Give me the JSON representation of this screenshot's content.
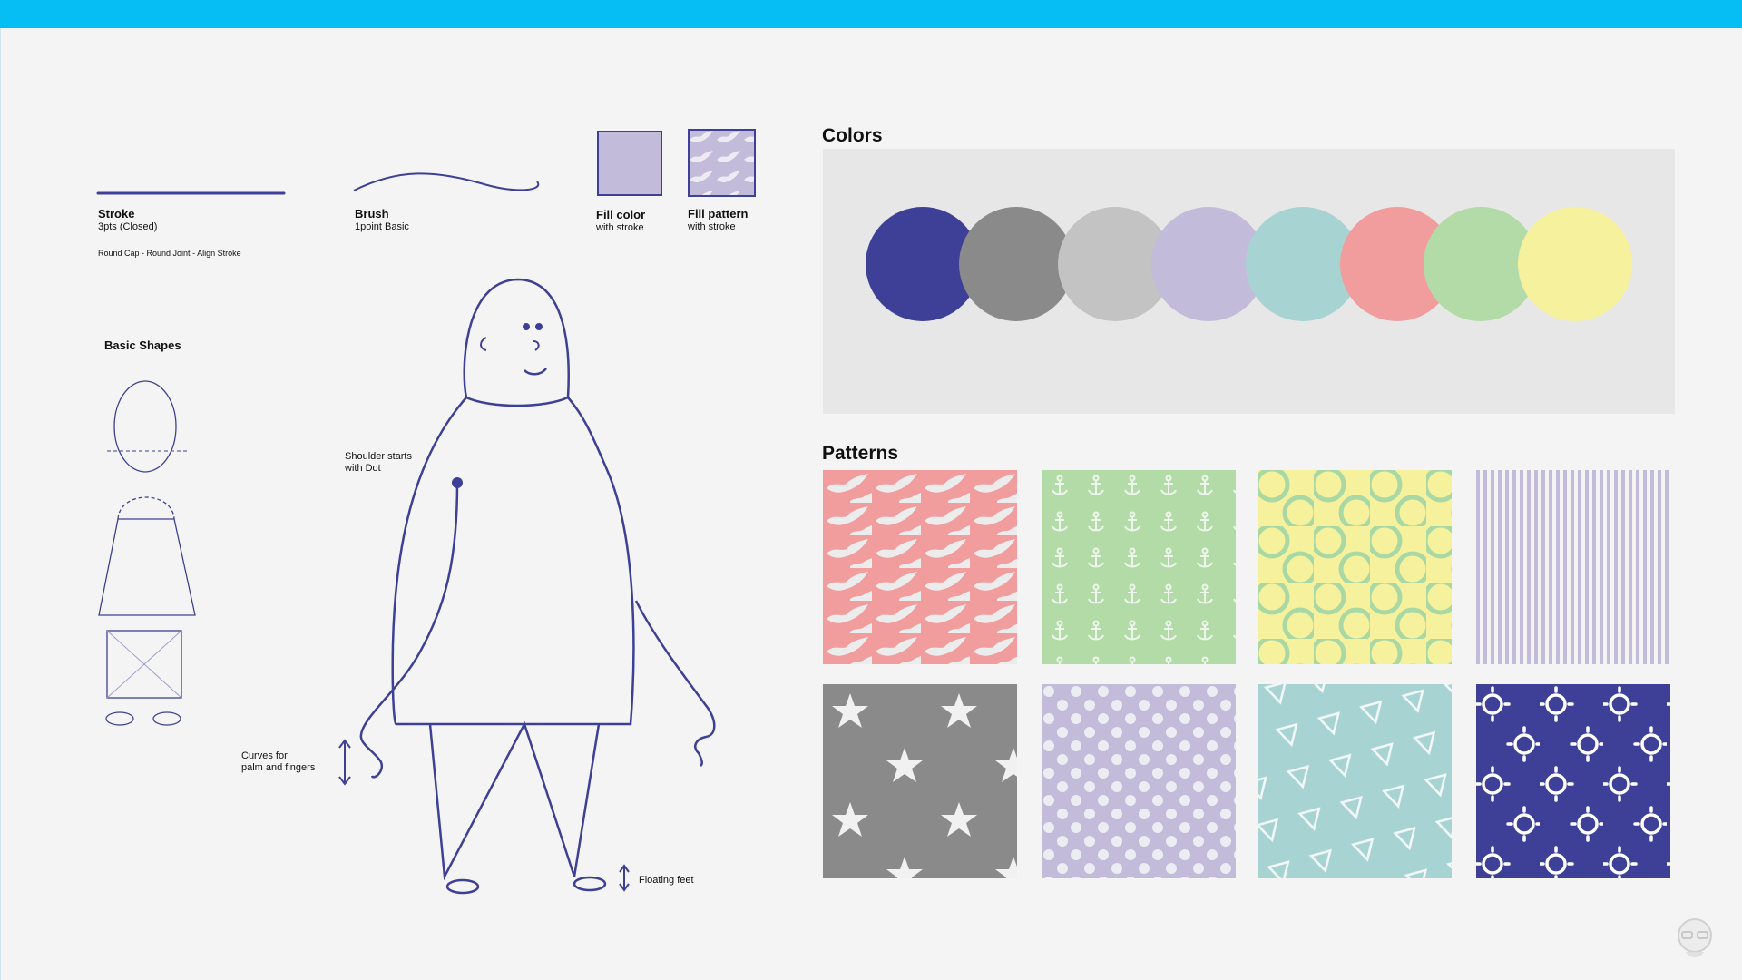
{
  "strokes": {
    "stroke": {
      "title": "Stroke",
      "sub": "3pts (Closed)",
      "note": "Round Cap - Round Joint - Align Stroke"
    },
    "brush": {
      "title": "Brush",
      "sub": "1point Basic"
    },
    "fill_color": {
      "title": "Fill color",
      "sub": "with stroke"
    },
    "fill_pattern": {
      "title": "Fill pattern",
      "sub": "with stroke"
    }
  },
  "basic_shapes": {
    "title": "Basic Shapes"
  },
  "annotations": {
    "shoulder": [
      "Shoulder starts",
      "with Dot"
    ],
    "curves": [
      "Curves for",
      "palm and fingers"
    ],
    "feet": "Floating feet"
  },
  "colors": {
    "title": "Colors",
    "swatches": [
      "#3d4096",
      "#8a8a8a",
      "#c3c3c3",
      "#c2bcda",
      "#a8d3d3",
      "#f19d9e",
      "#b2dba7",
      "#f6f19d"
    ]
  },
  "patterns": {
    "title": "Patterns",
    "tiles": [
      {
        "name": "birds",
        "bg": "#f19d9e",
        "fg": "#ececec"
      },
      {
        "name": "anchors",
        "bg": "#b2dba7",
        "fg": "#eef6ec"
      },
      {
        "name": "rings",
        "bg": "#f6f19d",
        "fg": "#a9d8a4"
      },
      {
        "name": "stripes",
        "bg": "#f4f4f4",
        "fg": "#c2bcda"
      },
      {
        "name": "stars",
        "bg": "#8a8a8a",
        "fg": "#f1f1f1"
      },
      {
        "name": "dots",
        "bg": "#c2bcda",
        "fg": "#ececf3"
      },
      {
        "name": "triangles",
        "bg": "#a8d3d3",
        "fg": "#f3f9f9"
      },
      {
        "name": "suns",
        "bg": "#3d4096",
        "fg": "#ffffff"
      }
    ]
  },
  "accent_color": "#3d4096"
}
